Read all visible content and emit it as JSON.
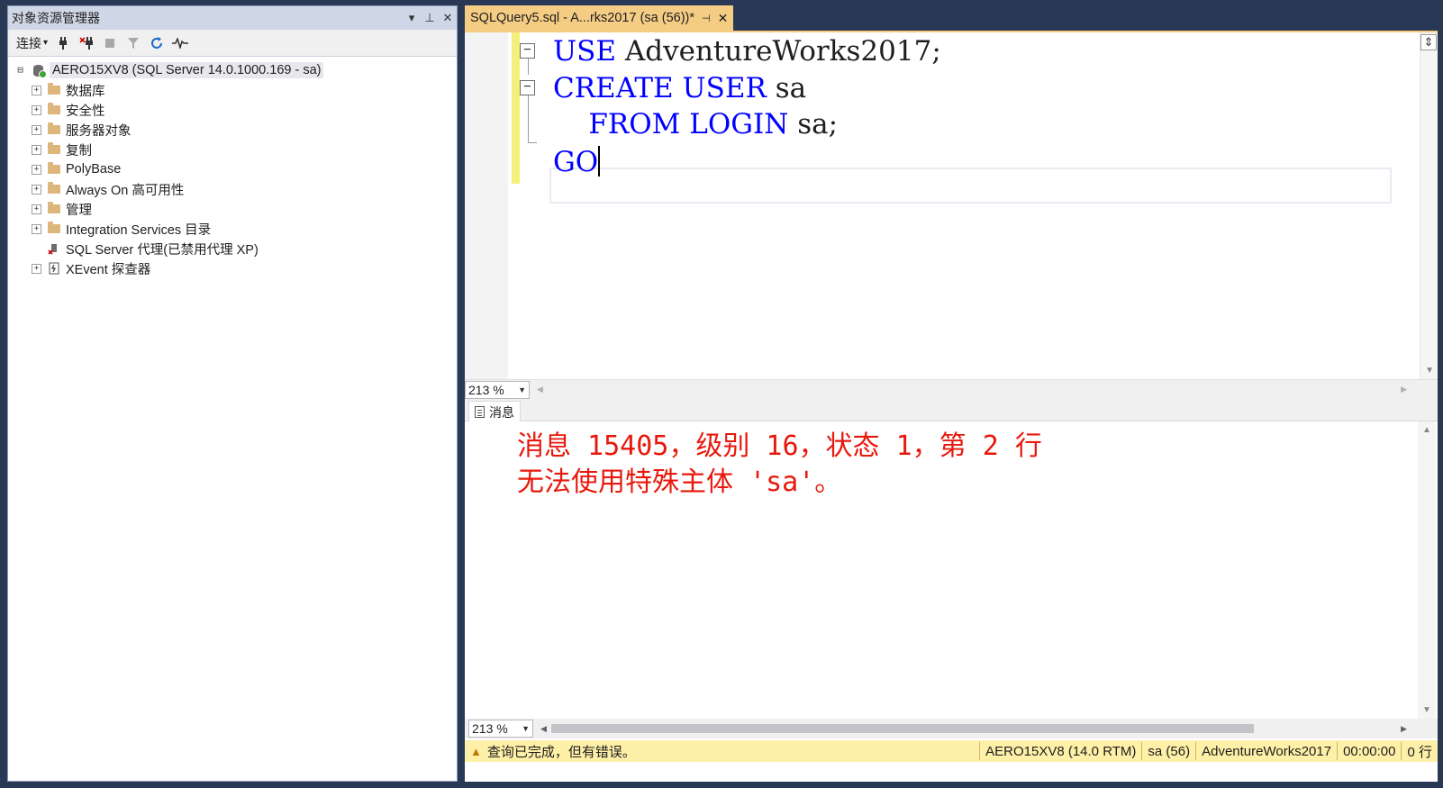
{
  "object_explorer": {
    "title": "对象资源管理器",
    "title_controls": [
      "▾",
      "⊥",
      "✕"
    ],
    "toolbar": {
      "connect_label": "连接",
      "connect_arrow": "▾"
    },
    "root": {
      "expander": "⊟",
      "label": "AERO15XV8 (SQL Server 14.0.1000.169 - sa)"
    },
    "children": [
      {
        "label": "数据库",
        "icon": "folder-icon",
        "expander": "+"
      },
      {
        "label": "安全性",
        "icon": "folder-icon",
        "expander": "+"
      },
      {
        "label": "服务器对象",
        "icon": "folder-icon",
        "expander": "+"
      },
      {
        "label": "复制",
        "icon": "folder-icon",
        "expander": "+"
      },
      {
        "label": "PolyBase",
        "icon": "folder-icon",
        "expander": "+"
      },
      {
        "label": "Always On 高可用性",
        "icon": "folder-icon",
        "expander": "+"
      },
      {
        "label": "管理",
        "icon": "folder-icon",
        "expander": "+"
      },
      {
        "label": "Integration Services 目录",
        "icon": "folder-icon",
        "expander": "+"
      },
      {
        "label": "SQL Server 代理(已禁用代理 XP)",
        "icon": "sql-agent-icon",
        "expander": ""
      },
      {
        "label": "XEvent 探查器",
        "icon": "xevent-icon",
        "expander": "+"
      }
    ]
  },
  "editor": {
    "tab_title": "SQLQuery5.sql - A...rks2017 (sa (56))*",
    "tab_pin": "⊣",
    "tab_close": "✕",
    "code": {
      "line1_kw": "USE",
      "line1_rest": " AdventureWorks2017;",
      "line2_kw": "CREATE USER",
      "line2_rest": " sa",
      "line3_indent": "    ",
      "line3_kw": "FROM LOGIN",
      "line3_rest": " sa;",
      "line4_kw": "GO"
    },
    "zoom_top": "213 %",
    "zoom_bottom": "213 %"
  },
  "results": {
    "tab_label": "消息",
    "messages": [
      "消息 15405，级别 16，状态 1，第 2 行",
      "无法使用特殊主体 'sa'。"
    ]
  },
  "status": {
    "message": "查询已完成，但有错误。",
    "server": "AERO15XV8 (14.0 RTM)",
    "user": "sa (56)",
    "database": "AdventureWorks2017",
    "elapsed": "00:00:00",
    "rows": "0 行"
  },
  "colors": {
    "keyword": "#0000ff",
    "error_text": "#e8180c",
    "tab_active": "#f5cc84",
    "statusbar": "#fff0a8",
    "chrome": "#293955"
  }
}
